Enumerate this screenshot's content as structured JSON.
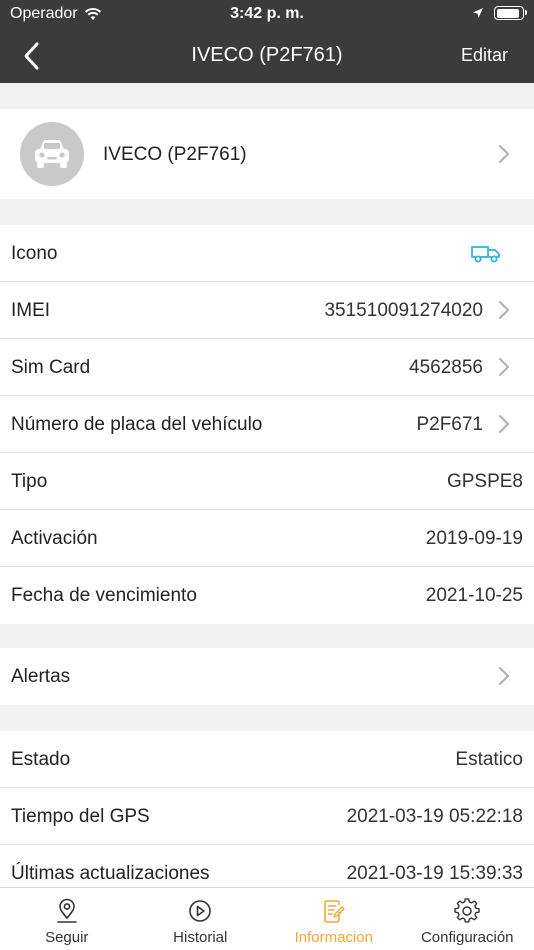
{
  "status_bar": {
    "carrier": "Operador",
    "time": "3:42 p. m."
  },
  "nav": {
    "title": "IVECO (P2F761)",
    "edit": "Editar"
  },
  "vehicle": {
    "name": "IVECO (P2F761)"
  },
  "details": [
    {
      "label": "Icono"
    },
    {
      "label": "IMEI",
      "value": "351510091274020"
    },
    {
      "label": "Sim Card",
      "value": "4562856"
    },
    {
      "label": "Número de placa del vehículo",
      "value": "P2F671"
    },
    {
      "label": "Tipo",
      "value": "GPSPE8"
    },
    {
      "label": "Activación",
      "value": "2019-09-19"
    },
    {
      "label": "Fecha de vencimiento",
      "value": "2021-10-25"
    }
  ],
  "alerts": {
    "label": "Alertas"
  },
  "status": [
    {
      "label": "Estado",
      "value": "Estatico"
    },
    {
      "label": "Tiempo del GPS",
      "value": "2021-03-19 05:22:18"
    },
    {
      "label": "Últimas actualizaciones",
      "value": "2021-03-19 15:39:33"
    }
  ],
  "tabs": [
    {
      "label": "Seguir",
      "icon": "location-pin-icon"
    },
    {
      "label": "Historial",
      "icon": "play-circle-icon"
    },
    {
      "label": "Informacion",
      "icon": "document-edit-icon",
      "active": true
    },
    {
      "label": "Configuración",
      "icon": "gear-icon"
    }
  ],
  "colors": {
    "header": "#3b3b3b",
    "accent": "#f5a53a",
    "truck_icon": "#29b6d6"
  }
}
